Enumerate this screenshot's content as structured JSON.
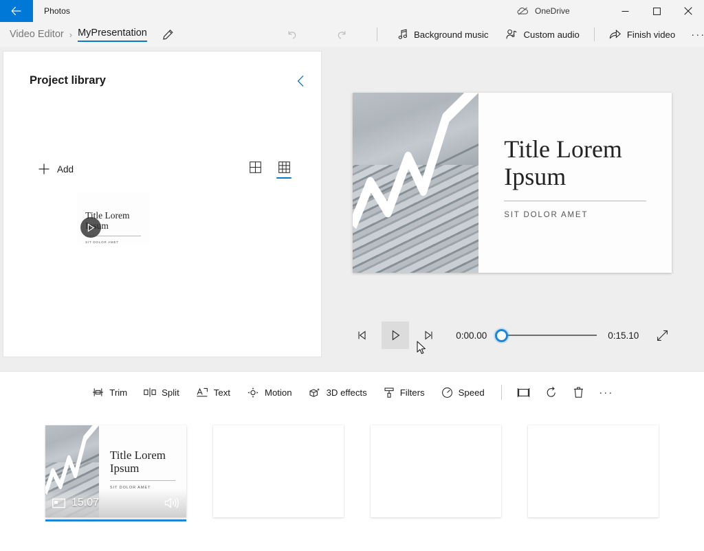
{
  "titlebar": {
    "app_name": "Photos",
    "back_icon": "back-arrow-icon",
    "onedrive_label": "OneDrive",
    "onedrive_icon": "onedrive-cloud-offline-icon",
    "minimize": "─",
    "maximize": "☐",
    "close": "✕"
  },
  "commandbar": {
    "breadcrumb_parent": "Video Editor",
    "breadcrumb_separator": "›",
    "breadcrumb_current": "MyPresentation",
    "rename_icon": "pencil-icon",
    "undo_icon": "undo-icon",
    "redo_icon": "redo-icon",
    "items": [
      {
        "label": "Background music",
        "icon": "music-note-icon"
      },
      {
        "label": "Custom audio",
        "icon": "person-audio-icon"
      },
      {
        "label": "Finish video",
        "icon": "export-share-icon"
      }
    ],
    "overflow": "···"
  },
  "library": {
    "title": "Project library",
    "collapse_icon": "chevron-left-icon",
    "add_label": "Add",
    "add_icon": "plus-icon",
    "view_modes": [
      {
        "name": "grid-large-icon",
        "selected": false
      },
      {
        "name": "grid-small-icon",
        "selected": true
      }
    ],
    "item": {
      "title": "Title Lorem Ipsum",
      "subtitle": "SIT DOLOR AMET",
      "play_icon": "play-overlay-icon"
    }
  },
  "preview": {
    "slide_title_line1": "Title Lorem",
    "slide_title_line2": "Ipsum",
    "slide_subtitle": "SIT DOLOR AMET"
  },
  "playback": {
    "prev_frame_icon": "previous-frame-icon",
    "play_icon": "play-icon",
    "next_frame_icon": "next-frame-icon",
    "current_time": "0:00.00",
    "total_time": "0:15.10",
    "fullscreen_icon": "fullscreen-icon",
    "progress_percent": 0
  },
  "timeline": {
    "tools": [
      {
        "label": "Trim",
        "icon": "trim-icon"
      },
      {
        "label": "Split",
        "icon": "split-icon"
      },
      {
        "label": "Text",
        "icon": "text-icon"
      },
      {
        "label": "Motion",
        "icon": "motion-icon"
      },
      {
        "label": "3D effects",
        "icon": "cube-3d-icon"
      },
      {
        "label": "Filters",
        "icon": "filters-icon"
      },
      {
        "label": "Speed",
        "icon": "speed-gauge-icon"
      }
    ],
    "icon_tools": [
      {
        "name": "resize-frame-icon"
      },
      {
        "name": "rotate-icon"
      },
      {
        "name": "delete-trash-icon"
      },
      {
        "name": "more-options-icon"
      }
    ],
    "clips": [
      {
        "title_line1": "Title Lorem",
        "title_line2": "Ipsum",
        "subtitle": "SIT DOLOR AMET",
        "duration": "15.07",
        "video_icon": "film-strip-icon",
        "audio_icon": "speaker-volume-icon",
        "selected": true
      }
    ],
    "empty_slots": 3
  },
  "colors": {
    "accent_blue": "#0078d7",
    "selection_blue": "#1a86d8",
    "tab_underline": "#0a78c8",
    "close_red": "#e81123"
  }
}
